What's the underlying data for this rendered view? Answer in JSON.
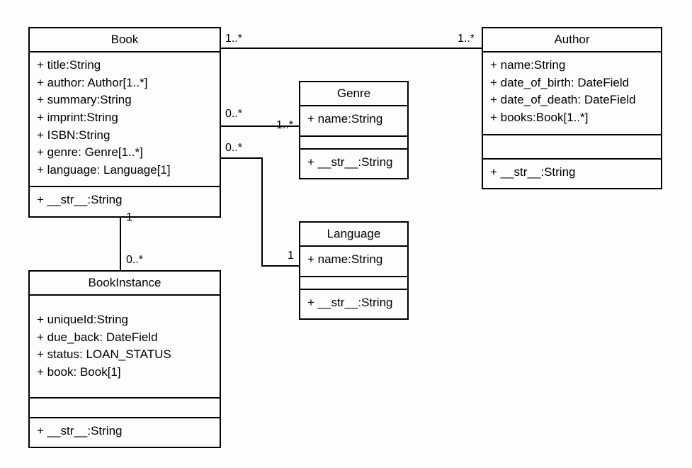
{
  "classes": {
    "book": {
      "title": "Book",
      "attrs": [
        "+ title:String",
        "+ author: Author[1..*]",
        "+ summary:String",
        "+ imprint:String",
        "+ ISBN:String",
        "+ genre: Genre[1..*]",
        "+ language: Language[1]"
      ],
      "methods": [
        "+ __str__:String"
      ]
    },
    "author": {
      "title": "Author",
      "attrs": [
        "+ name:String",
        "+ date_of_birth: DateField",
        "+ date_of_death: DateField",
        "+ books:Book[1..*]"
      ],
      "methods": [
        "+ __str__:String"
      ]
    },
    "genre": {
      "title": "Genre",
      "attrs": [
        "+ name:String"
      ],
      "methods": [
        "+ __str__:String"
      ]
    },
    "language": {
      "title": "Language",
      "attrs": [
        "+ name:String"
      ],
      "methods": [
        "+ __str__:String"
      ]
    },
    "bookinstance": {
      "title": "BookInstance",
      "attrs": [
        "+ uniqueId:String",
        "+ due_back: DateField",
        "+ status: LOAN_STATUS",
        "+ book: Book[1]"
      ],
      "methods": [
        "+ __str__:String"
      ]
    }
  },
  "assoc_labels": {
    "book_author_left": "1..*",
    "book_author_right": "1..*",
    "book_genre_left": "0..*",
    "book_genre_right": "1..*",
    "book_language_left": "0..*",
    "book_language_right": "1",
    "book_instance_top": "1",
    "book_instance_bottom": "0..*"
  }
}
